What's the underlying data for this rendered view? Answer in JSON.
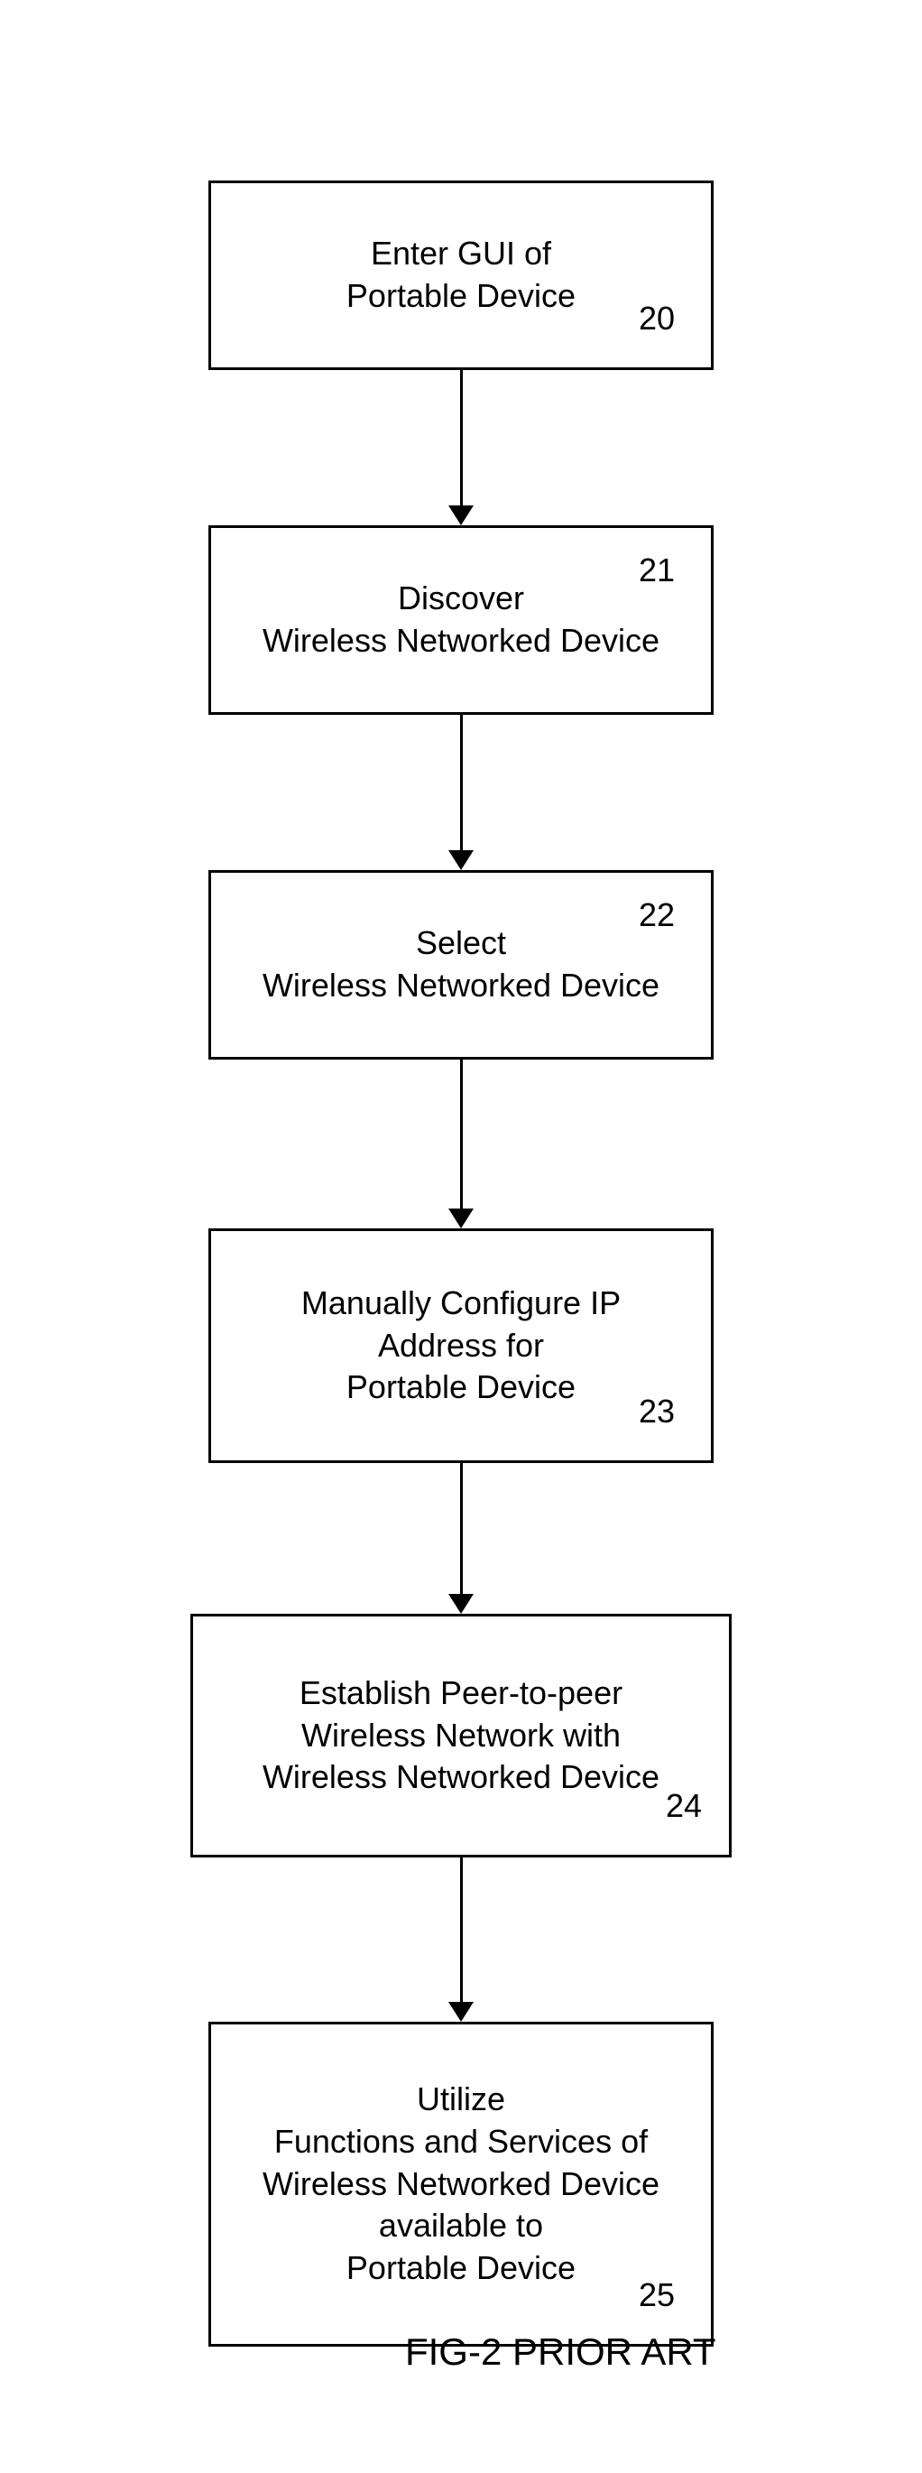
{
  "caption": "FIG-2 PRIOR ART",
  "steps": [
    {
      "id": "20",
      "lines": [
        "Enter GUI of",
        "Portable Device"
      ]
    },
    {
      "id": "21",
      "lines": [
        "Discover",
        "Wireless Networked Device"
      ]
    },
    {
      "id": "22",
      "lines": [
        "Select",
        "Wireless Networked Device"
      ]
    },
    {
      "id": "23",
      "lines": [
        "Manually Configure IP",
        "Address  for",
        "Portable Device"
      ]
    },
    {
      "id": "24",
      "lines": [
        "Establish Peer-to-peer",
        "Wireless Network with",
        "Wireless Networked Device"
      ]
    },
    {
      "id": "25",
      "lines": [
        "Utilize",
        "Functions and Services of",
        "Wireless Networked Device",
        "available to",
        "Portable Device"
      ]
    }
  ]
}
